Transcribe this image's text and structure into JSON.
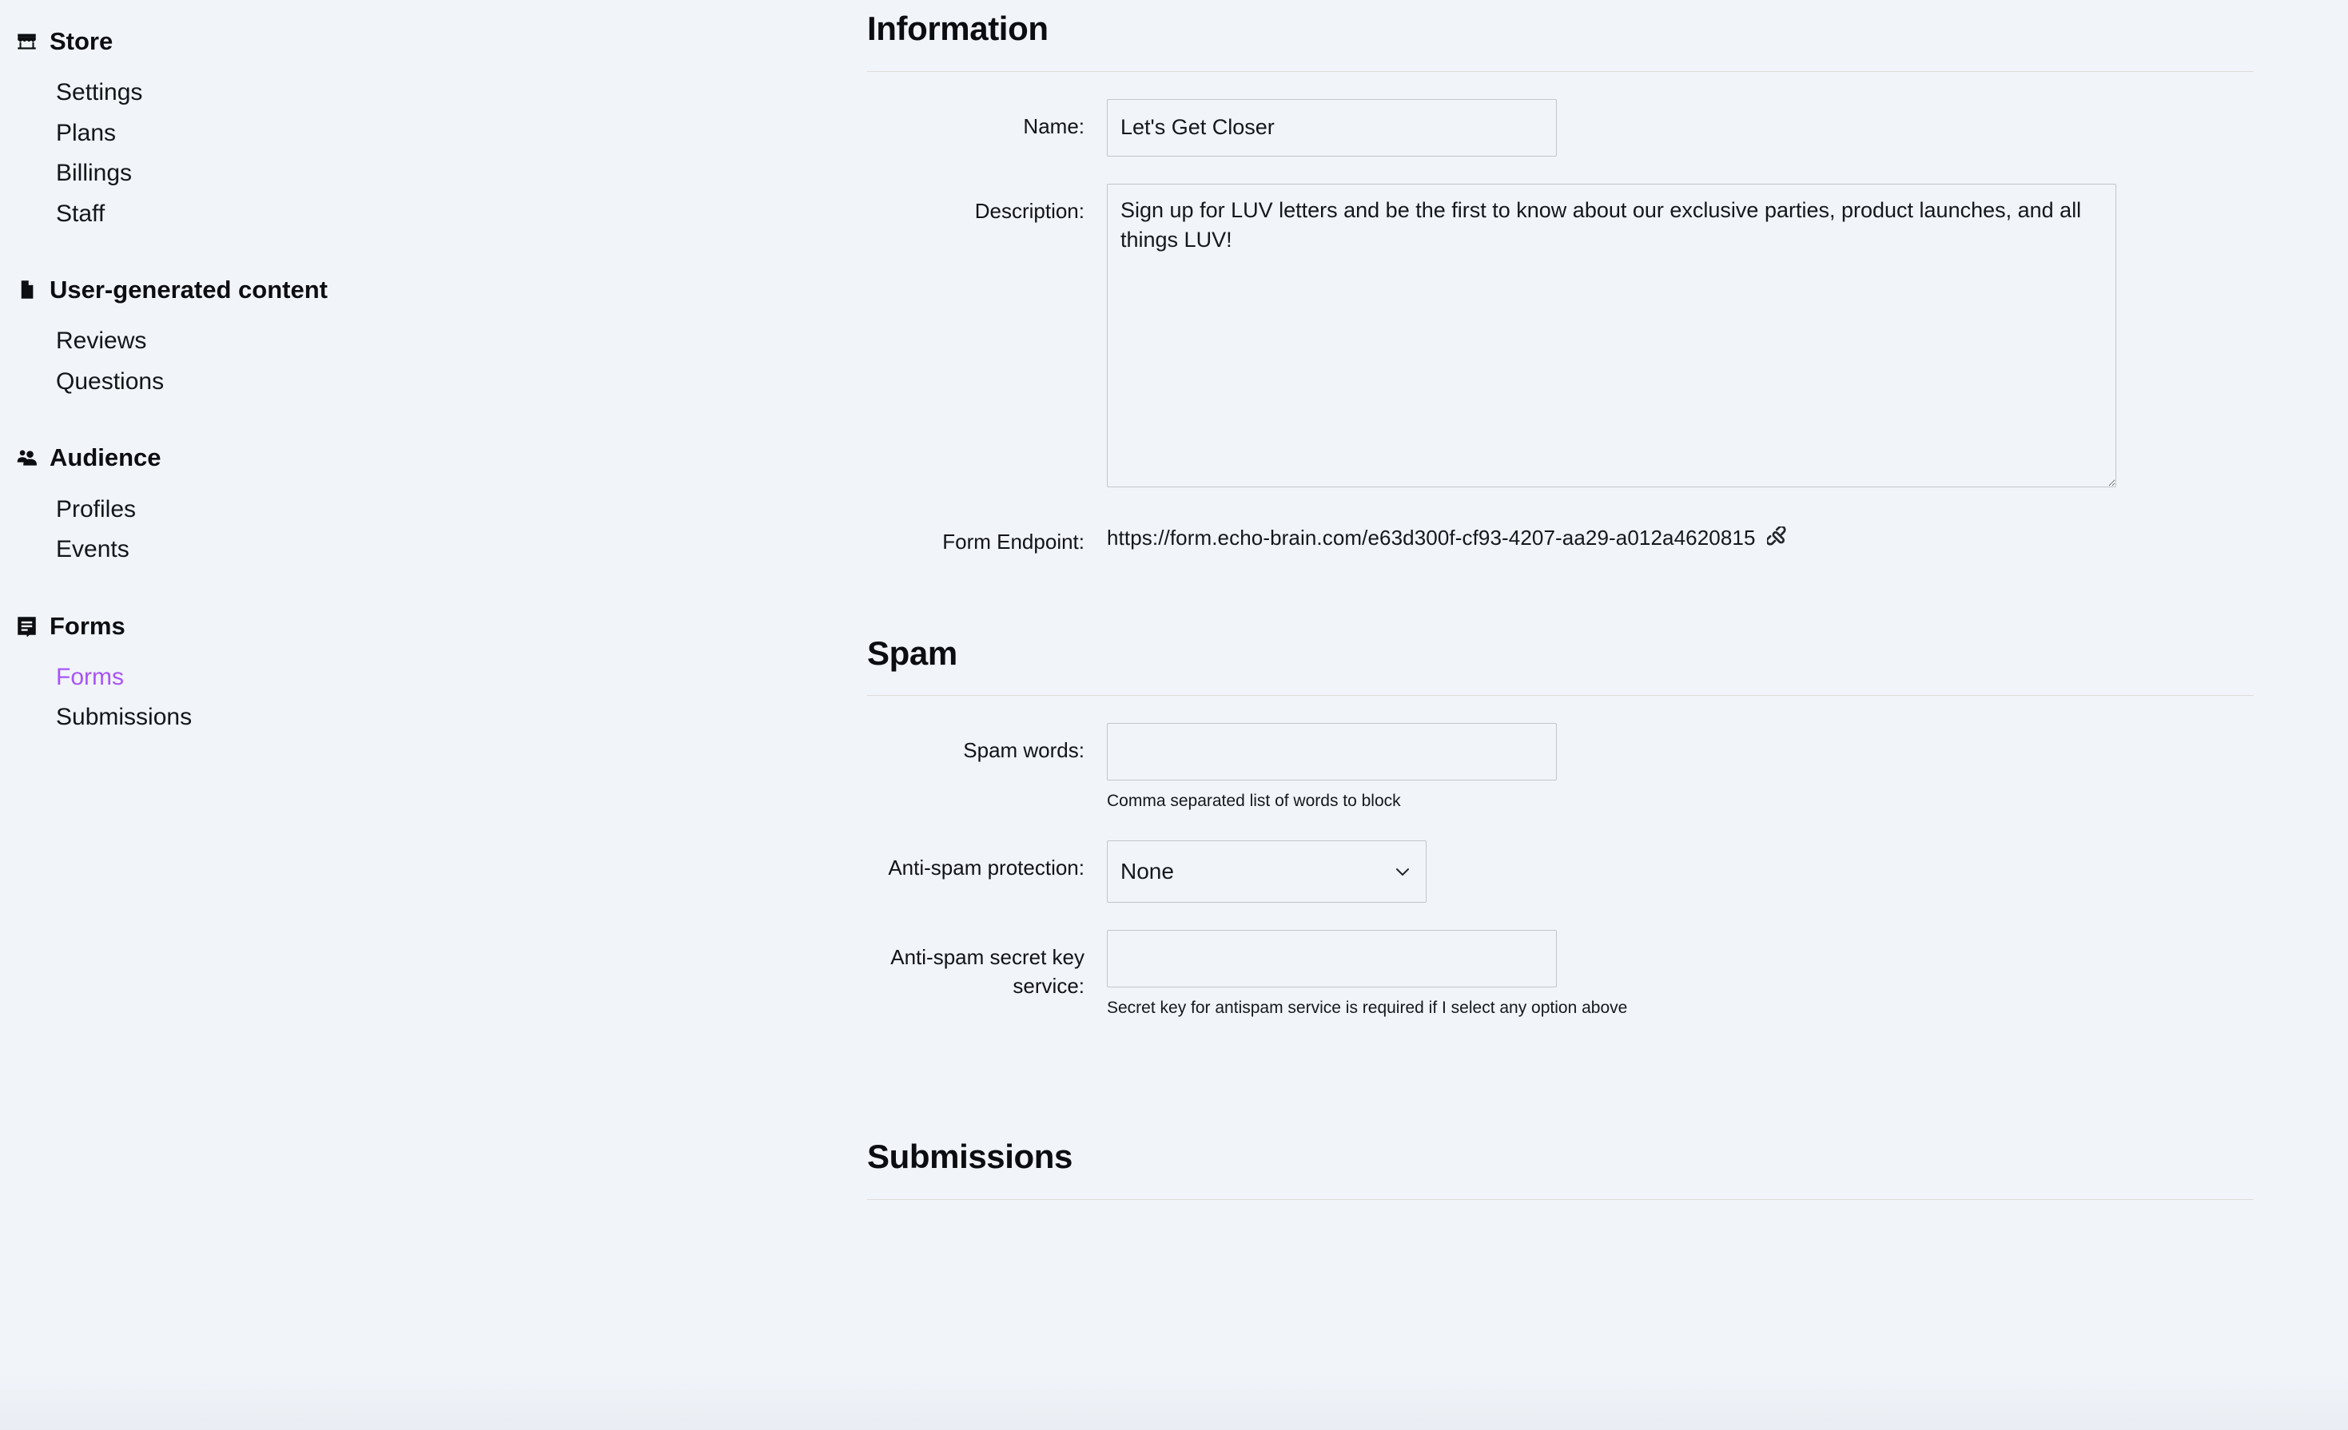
{
  "sidebar": {
    "groups": [
      {
        "icon": "storefront-icon",
        "title": "Store",
        "items": [
          {
            "label": "Settings",
            "active": false
          },
          {
            "label": "Plans",
            "active": false
          },
          {
            "label": "Billings",
            "active": false
          },
          {
            "label": "Staff",
            "active": false
          }
        ]
      },
      {
        "icon": "document-icon",
        "title": "User-generated content",
        "items": [
          {
            "label": "Reviews",
            "active": false
          },
          {
            "label": "Questions",
            "active": false
          }
        ]
      },
      {
        "icon": "people-icon",
        "title": "Audience",
        "items": [
          {
            "label": "Profiles",
            "active": false
          },
          {
            "label": "Events",
            "active": false
          }
        ]
      },
      {
        "icon": "form-icon",
        "title": "Forms",
        "items": [
          {
            "label": "Forms",
            "active": true
          },
          {
            "label": "Submissions",
            "active": false
          }
        ]
      }
    ]
  },
  "main": {
    "information": {
      "heading": "Information",
      "name": {
        "label": "Name:",
        "value": "Let's Get Closer",
        "placeholder": ""
      },
      "description": {
        "label": "Description:",
        "value": "Sign up for LUV letters and be the first to know about our exclusive parties, product launches, and all things LUV!",
        "placeholder": ""
      },
      "form_endpoint": {
        "label": "Form Endpoint:",
        "url": "https://form.echo-brain.com/e63d300f-cf93-4207-aa29-a012a4620815",
        "icon": "link-plug-icon"
      }
    },
    "spam": {
      "heading": "Spam",
      "spam_words": {
        "label": "Spam words:",
        "value": "",
        "placeholder": "",
        "help": "Comma separated list of words to block"
      },
      "antispam_protection": {
        "label": "Anti-spam protection:",
        "value": "None",
        "options": [
          "None"
        ]
      },
      "antispam_secret": {
        "label": "Anti-spam secret key service:",
        "value": "",
        "placeholder": "",
        "help": "Secret key for antispam service is required if I select any option above"
      }
    },
    "submissions": {
      "heading": "Submissions"
    }
  },
  "colors": {
    "page_background": "#f1f4f9",
    "accent_active": "#a855f7",
    "text_primary": "#111318",
    "border": "#c3c5c8",
    "rule": "#dedcda"
  }
}
